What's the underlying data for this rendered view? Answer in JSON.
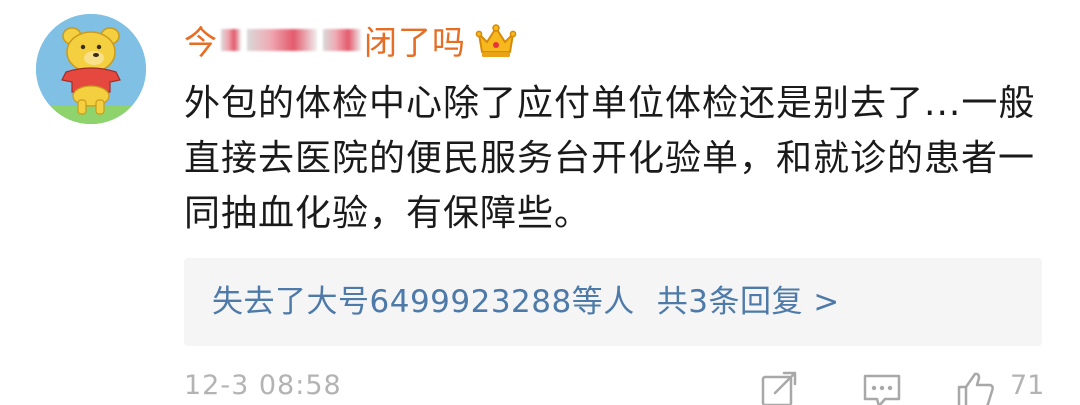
{
  "comment": {
    "username_start": "今",
    "username_end": "闭了吗",
    "badge_icon": "crown-icon",
    "text": "外包的体检中心除了应付单位体检还是别去了...一般直接去医院的便民服务台开化验单，和就诊的患者一同抽血化验，有保障些。",
    "replies": {
      "users": "失去了大号6499923288等人",
      "count": "共3条回复 >"
    },
    "timestamp": "12-3 08:58",
    "like_count": "71"
  },
  "colors": {
    "username": "#e76d24",
    "link": "#4d7aa8",
    "meta": "#b3b3b3",
    "reply_bg": "#f5f5f6"
  },
  "icons": [
    "share-icon",
    "comment-icon",
    "like-icon"
  ]
}
